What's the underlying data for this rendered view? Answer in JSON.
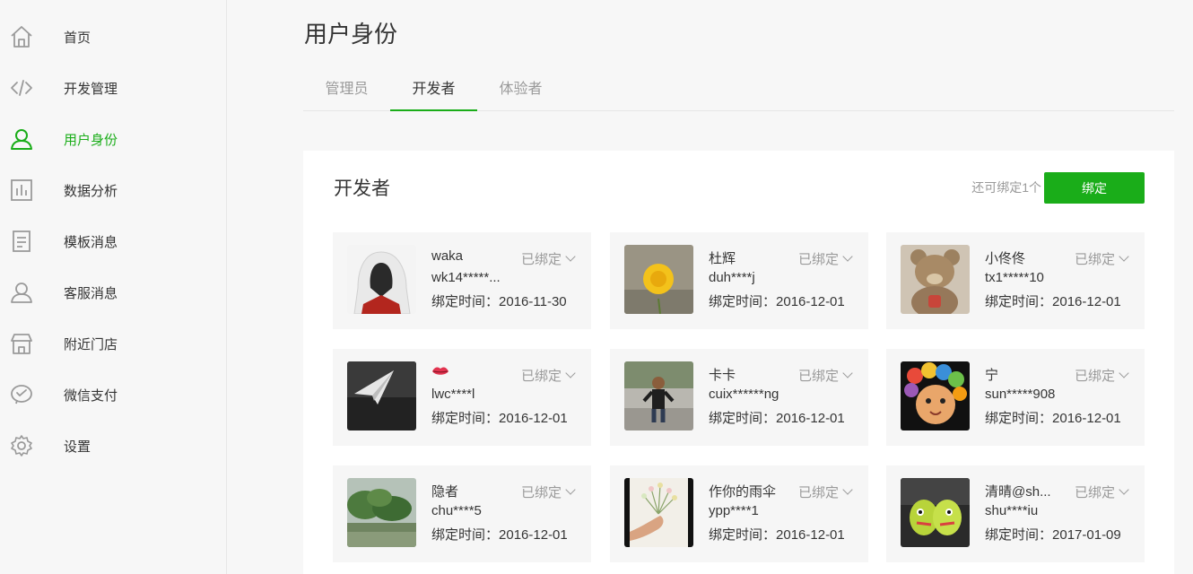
{
  "sidebar": {
    "items": [
      {
        "label": "首页",
        "icon": "home-icon"
      },
      {
        "label": "开发管理",
        "icon": "code-icon"
      },
      {
        "label": "用户身份",
        "icon": "user-icon",
        "active": true
      },
      {
        "label": "数据分析",
        "icon": "chart-icon"
      },
      {
        "label": "模板消息",
        "icon": "document-icon"
      },
      {
        "label": "客服消息",
        "icon": "customer-service-icon"
      },
      {
        "label": "附近门店",
        "icon": "store-icon"
      },
      {
        "label": "微信支付",
        "icon": "payment-icon"
      },
      {
        "label": "设置",
        "icon": "gear-icon"
      }
    ]
  },
  "header": {
    "title": "用户身份",
    "tabs": [
      {
        "label": "管理员"
      },
      {
        "label": "开发者",
        "active": true
      },
      {
        "label": "体验者"
      }
    ]
  },
  "panel": {
    "title": "开发者",
    "quota": "还可绑定1个",
    "bind_button": "绑定",
    "status_label": "已绑定",
    "time_prefix": "绑定时间：",
    "cards": [
      {
        "name": "waka",
        "id": "wk14*****...",
        "time": "2016-11-30"
      },
      {
        "name": "杜辉",
        "id": "duh****j",
        "time": "2016-12-01"
      },
      {
        "name": "小佟佟",
        "id": "tx1*****10",
        "time": "2016-12-01"
      },
      {
        "name": "",
        "id": "lwc****l",
        "time": "2016-12-01"
      },
      {
        "name": "卡卡",
        "id": "cuix******ng",
        "time": "2016-12-01"
      },
      {
        "name": "宁",
        "id": "sun*****908",
        "time": "2016-12-01"
      },
      {
        "name": "隐者",
        "id": "chu****5",
        "time": "2016-12-01"
      },
      {
        "name": "作你的雨伞",
        "id": "ypp****1",
        "time": "2016-12-01"
      },
      {
        "name": "清晴@sh...",
        "id": "shu****iu",
        "time": "2017-01-09"
      }
    ]
  },
  "colors": {
    "accent": "#1aad19",
    "muted": "#9a9a9a",
    "text": "#353535"
  }
}
